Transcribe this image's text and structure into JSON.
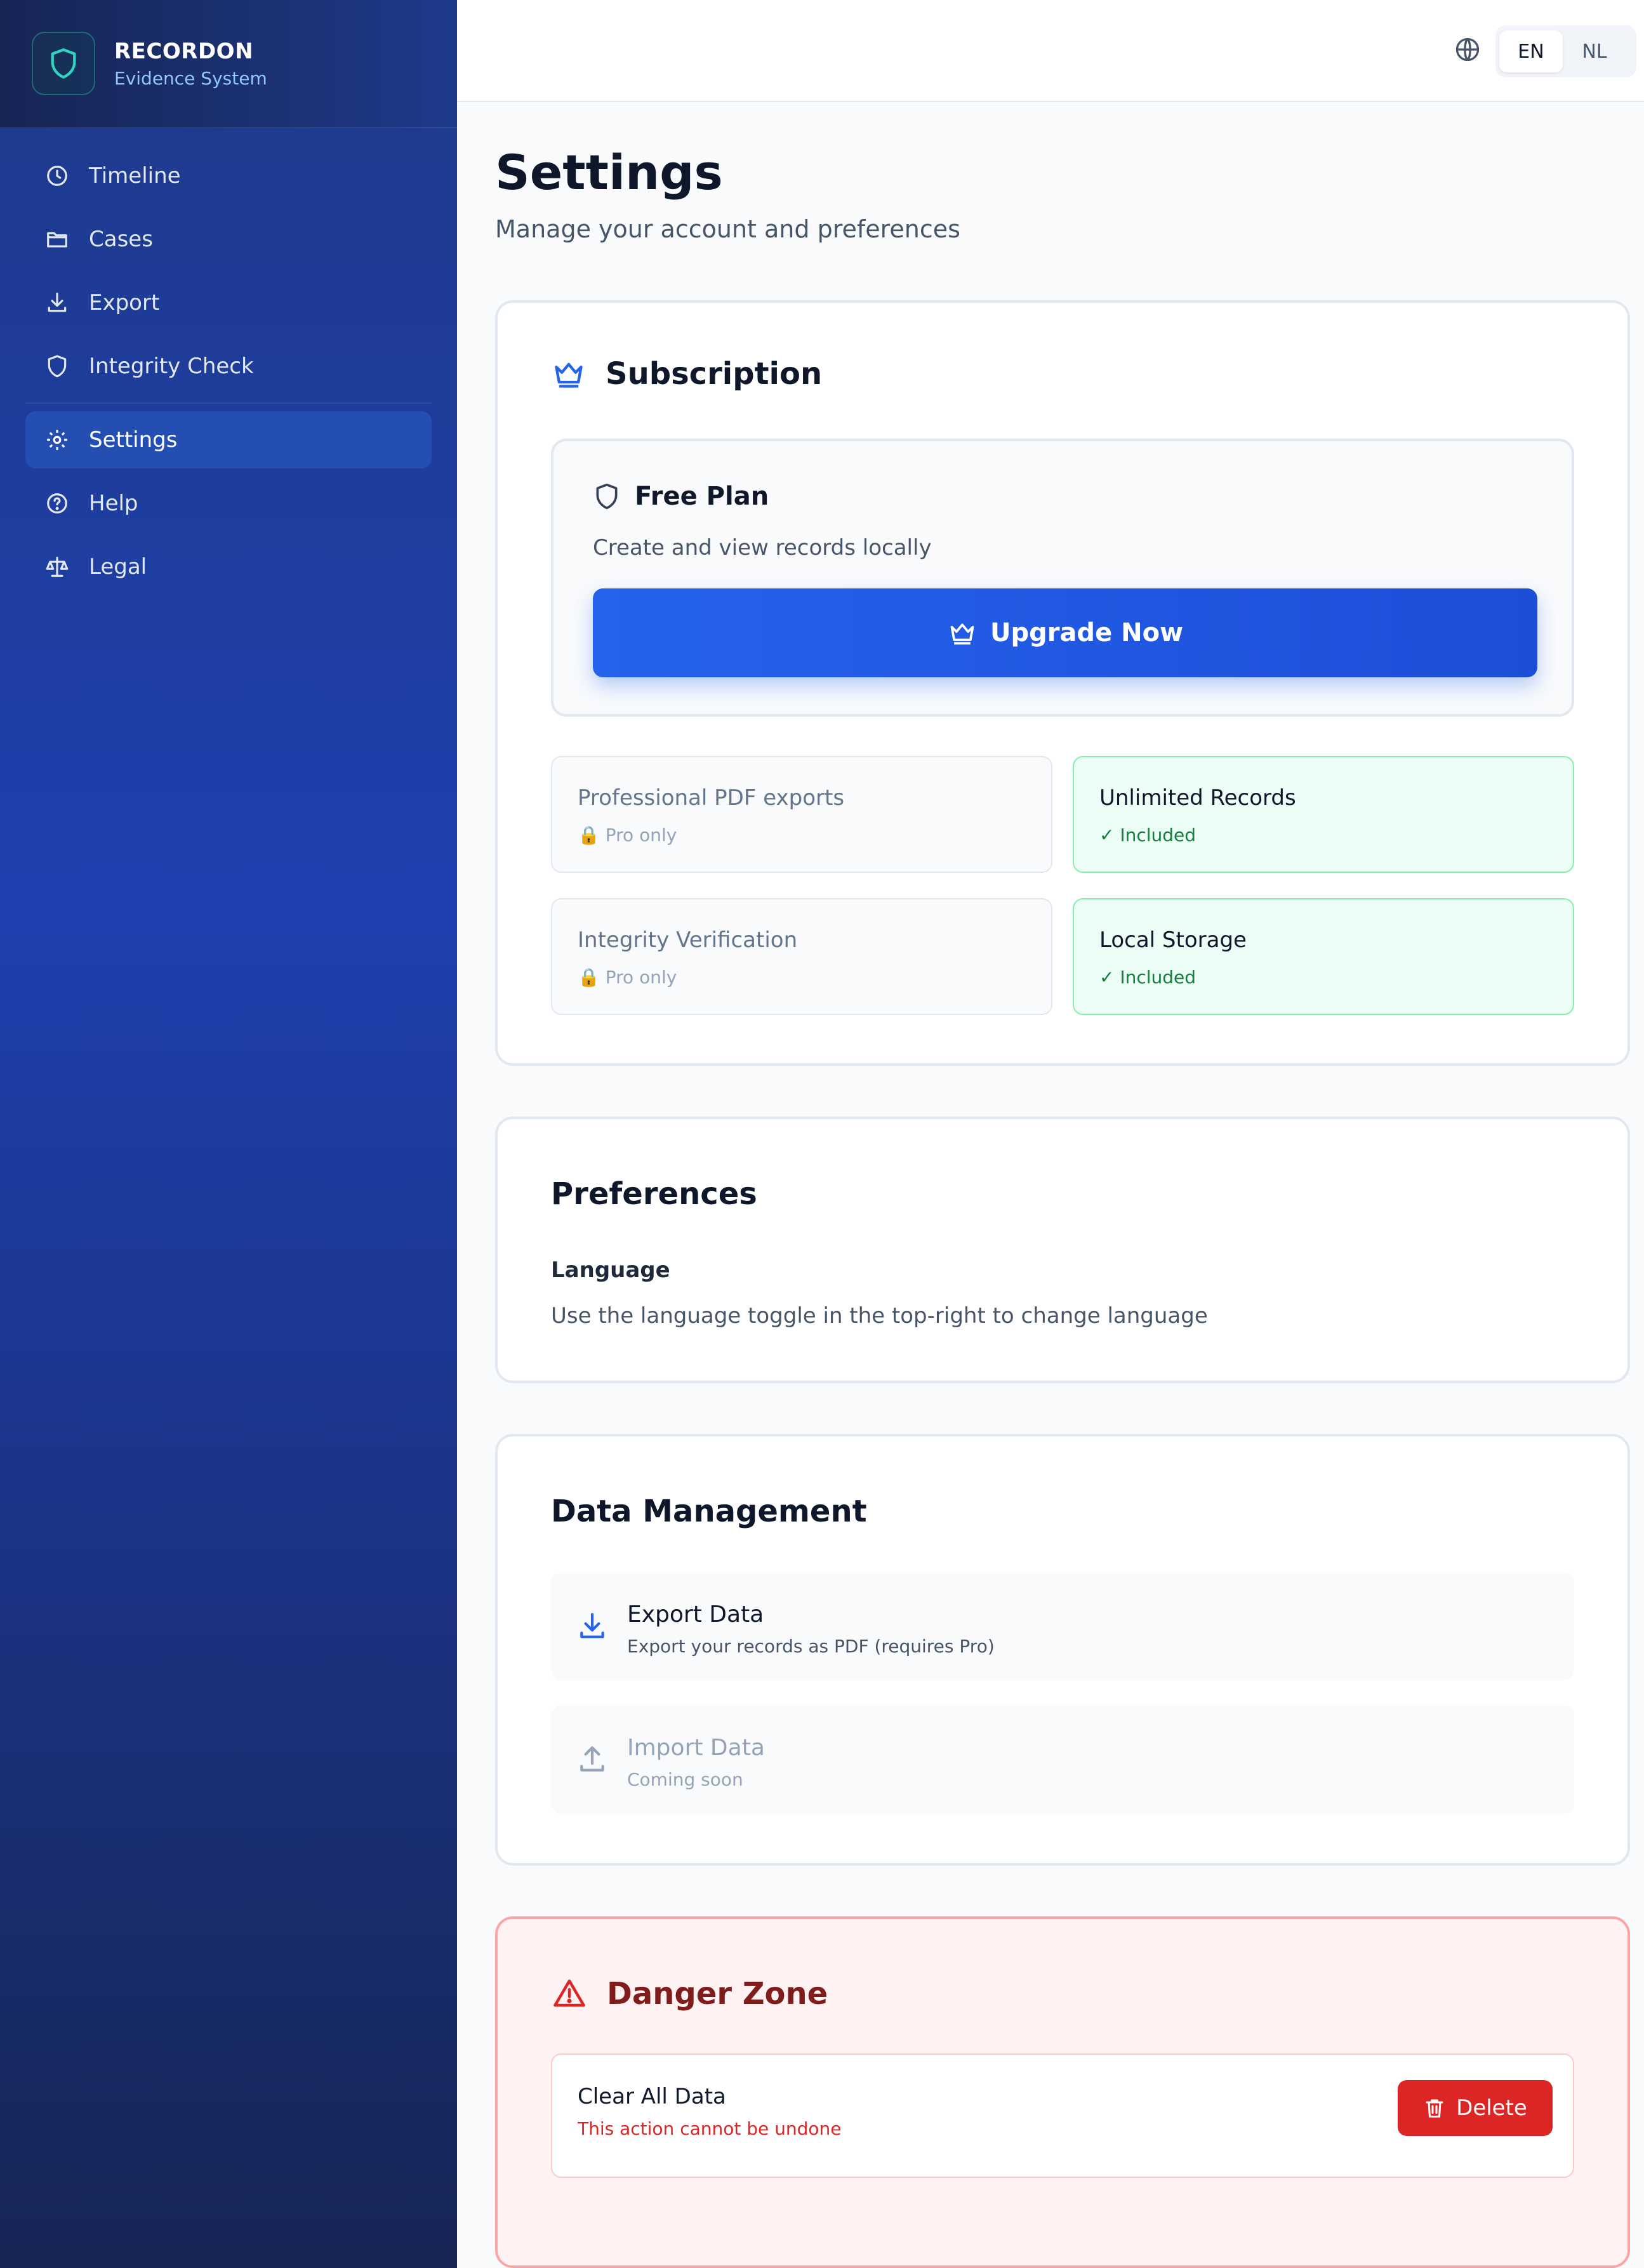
{
  "brand": {
    "name": "RECORDON",
    "subtitle": "Evidence System"
  },
  "nav": {
    "items": [
      {
        "label": "Timeline",
        "icon": "clock-icon"
      },
      {
        "label": "Cases",
        "icon": "folder-icon"
      },
      {
        "label": "Export",
        "icon": "download-icon"
      },
      {
        "label": "Integrity Check",
        "icon": "shield-icon"
      },
      {
        "label": "Settings",
        "icon": "gear-icon",
        "active": true
      },
      {
        "label": "Help",
        "icon": "help-circle-icon"
      },
      {
        "label": "Legal",
        "icon": "scale-icon"
      }
    ]
  },
  "topbar": {
    "languages": [
      "EN",
      "NL"
    ],
    "active_language": "EN"
  },
  "page": {
    "title": "Settings",
    "subtitle": "Manage your account and preferences"
  },
  "subscription": {
    "title": "Subscription",
    "plan_name": "Free Plan",
    "plan_desc": "Create and view records locally",
    "upgrade_label": "Upgrade Now",
    "features": [
      {
        "title": "Professional PDF exports",
        "status": "🔒 Pro only",
        "included": false
      },
      {
        "title": "Unlimited Records",
        "status": "✓ Included",
        "included": true
      },
      {
        "title": "Integrity Verification",
        "status": "🔒 Pro only",
        "included": false
      },
      {
        "title": "Local Storage",
        "status": "✓ Included",
        "included": true
      }
    ]
  },
  "preferences": {
    "title": "Preferences",
    "language_label": "Language",
    "language_desc": "Use the language toggle in the top-right to change language"
  },
  "data_management": {
    "title": "Data Management",
    "export_title": "Export Data",
    "export_desc": "Export your records as PDF (requires Pro)",
    "import_title": "Import Data",
    "import_desc": "Coming soon"
  },
  "danger": {
    "title": "Danger Zone",
    "clear_title": "Clear All Data",
    "clear_desc": "This action cannot be undone",
    "delete_label": "Delete"
  },
  "colors": {
    "sidebar": "#1e3a8a",
    "accent": "#2563eb",
    "success": "#15803d",
    "danger": "#dc2626",
    "logo_accent": "#2dd4bf"
  }
}
